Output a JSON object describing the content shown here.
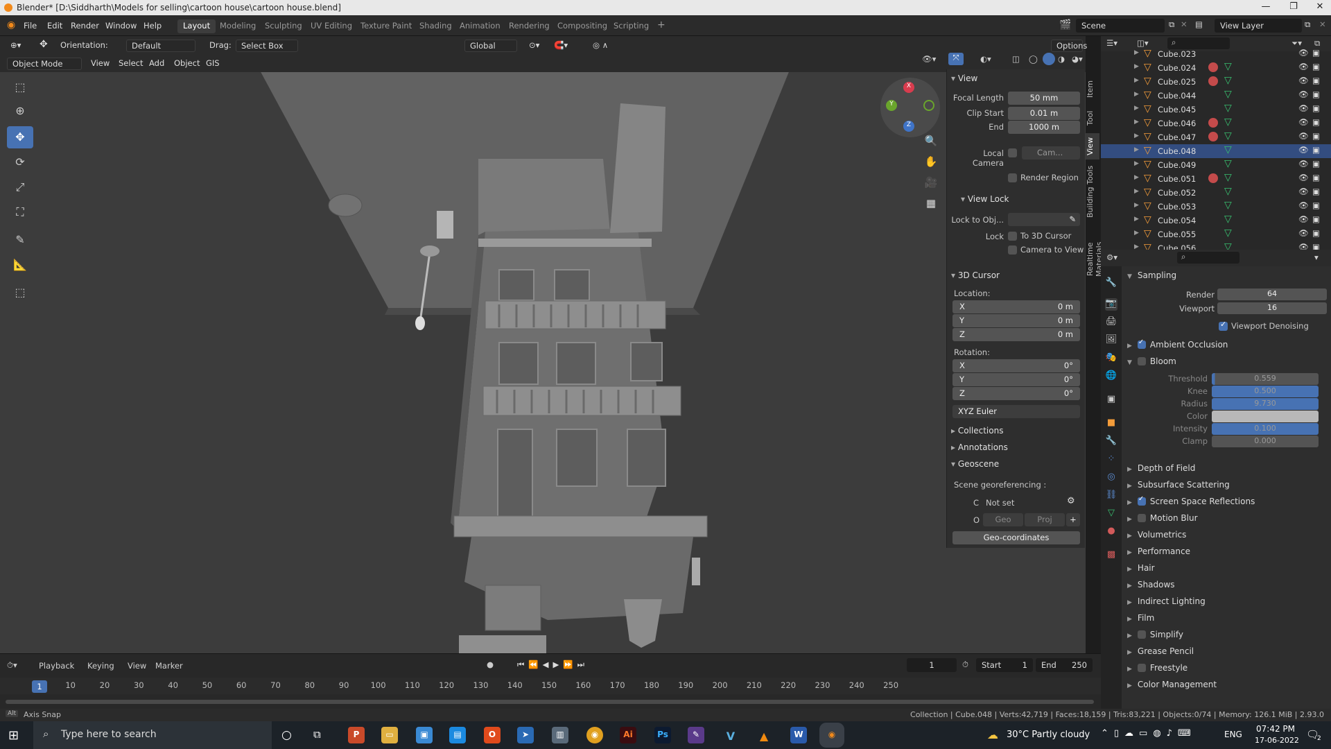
{
  "titlebar": {
    "title": "Blender* [D:\\Siddharth\\Models for selling\\cartoon house\\cartoon house.blend]",
    "minimize": "—",
    "maximize": "❐",
    "close": "✕"
  },
  "menu": [
    "File",
    "Edit",
    "Render",
    "Window",
    "Help"
  ],
  "workspaces": [
    "Layout",
    "Modeling",
    "Sculpting",
    "UV Editing",
    "Texture Paint",
    "Shading",
    "Animation",
    "Rendering",
    "Compositing",
    "Scripting"
  ],
  "workspace_add": "+",
  "scene": {
    "label": "Scene",
    "view_layer": "View Layer"
  },
  "header": {
    "orientation_label": "Orientation:",
    "orientation_value": "Default",
    "drag_label": "Drag:",
    "drag_value": "Select Box",
    "transform_orientation": "Global",
    "options": "Options"
  },
  "viewport_header": {
    "mode": "Object Mode",
    "items": [
      "View",
      "Select",
      "Add",
      "Object",
      "GIS"
    ]
  },
  "gizmo": {
    "x": "X",
    "y": "Y",
    "z": "Z"
  },
  "npanel": {
    "view_title": "View",
    "focal_length_label": "Focal Length",
    "focal_length": "50 mm",
    "clip_start_label": "Clip Start",
    "clip_start": "0.01 m",
    "end_label": "End",
    "end": "1000 m",
    "local_camera_label": "Local Camera",
    "local_camera_value": "Cam...",
    "render_region": "Render Region",
    "view_lock_title": "View Lock",
    "lock_to_obj_label": "Lock to Obj...",
    "lock_label": "Lock",
    "to_3d_cursor": "To 3D Cursor",
    "camera_to_view": "Camera to View",
    "cursor_title": "3D Cursor",
    "location_label": "Location:",
    "loc": [
      {
        "axis": "X",
        "value": "0 m"
      },
      {
        "axis": "Y",
        "value": "0 m"
      },
      {
        "axis": "Z",
        "value": "0 m"
      }
    ],
    "rotation_label": "Rotation:",
    "rot": [
      {
        "axis": "X",
        "value": "0°"
      },
      {
        "axis": "Y",
        "value": "0°"
      },
      {
        "axis": "Z",
        "value": "0°"
      }
    ],
    "rotation_mode": "XYZ Euler",
    "collections": "Collections",
    "annotations": "Annotations",
    "geoscene": "Geoscene",
    "georef_label": "Scene georeferencing :",
    "crs_c": "C",
    "crs_value": "Not set",
    "crs_o": "O",
    "geo": "Geo",
    "proj": "Proj",
    "add": "+",
    "geo_coords": "Geo-coordinates"
  },
  "side_tabs": [
    "Item",
    "Tool",
    "View",
    "Building Tools",
    "Realtime Materials"
  ],
  "outliner": {
    "rows": [
      {
        "name": "Cube.023",
        "m1": false,
        "m2": false
      },
      {
        "name": "Cube.024",
        "m1": true,
        "m2": true
      },
      {
        "name": "Cube.025",
        "m1": true,
        "m2": true
      },
      {
        "name": "Cube.044",
        "m1": false,
        "m2": true
      },
      {
        "name": "Cube.045",
        "m1": false,
        "m2": true
      },
      {
        "name": "Cube.046",
        "m1": true,
        "m2": true
      },
      {
        "name": "Cube.047",
        "m1": true,
        "m2": true
      },
      {
        "name": "Cube.048",
        "m1": false,
        "m2": true,
        "selected": true
      },
      {
        "name": "Cube.049",
        "m1": false,
        "m2": true
      },
      {
        "name": "Cube.051",
        "m1": true,
        "m2": true
      },
      {
        "name": "Cube.052",
        "m1": false,
        "m2": true
      },
      {
        "name": "Cube.053",
        "m1": false,
        "m2": true
      },
      {
        "name": "Cube.054",
        "m1": false,
        "m2": true
      },
      {
        "name": "Cube.055",
        "m1": false,
        "m2": true
      },
      {
        "name": "Cube.056",
        "m1": false,
        "m2": true
      }
    ]
  },
  "properties": {
    "sampling": "Sampling",
    "render_label": "Render",
    "render": "64",
    "viewport_label": "Viewport",
    "viewport": "16",
    "viewport_denoising": "Viewport Denoising",
    "ambient_occlusion": "Ambient Occlusion",
    "bloom": "Bloom",
    "bloom_fields": [
      {
        "label": "Threshold",
        "value": "0.559",
        "fill": 0.03
      },
      {
        "label": "Knee",
        "value": "0.500",
        "fill": 1.0
      },
      {
        "label": "Radius",
        "value": "9.730",
        "fill": 1.0
      },
      {
        "label": "Color",
        "value": "",
        "fill": 0
      },
      {
        "label": "Intensity",
        "value": "0.100",
        "fill": 1.0
      },
      {
        "label": "Clamp",
        "value": "0.000",
        "fill": 0
      }
    ],
    "sections": [
      {
        "label": "Depth of Field",
        "cb": null
      },
      {
        "label": "Subsurface Scattering",
        "cb": null
      },
      {
        "label": "Screen Space Reflections",
        "cb": true
      },
      {
        "label": "Motion Blur",
        "cb": false
      },
      {
        "label": "Volumetrics",
        "cb": null
      },
      {
        "label": "Performance",
        "cb": null
      },
      {
        "label": "Hair",
        "cb": null
      },
      {
        "label": "Shadows",
        "cb": null
      },
      {
        "label": "Indirect Lighting",
        "cb": null
      },
      {
        "label": "Film",
        "cb": null
      },
      {
        "label": "Simplify",
        "cb": false
      },
      {
        "label": "Grease Pencil",
        "cb": null
      },
      {
        "label": "Freestyle",
        "cb": false
      },
      {
        "label": "Color Management",
        "cb": null
      }
    ]
  },
  "timeline": {
    "menu": [
      "Playback",
      "Keying",
      "View",
      "Marker"
    ],
    "current_frame": "1",
    "start_label": "Start",
    "start": "1",
    "end_label": "End",
    "end": "250",
    "ticks": [
      "1",
      "10",
      "20",
      "30",
      "40",
      "50",
      "60",
      "70",
      "80",
      "90",
      "100",
      "110",
      "120",
      "130",
      "140",
      "150",
      "160",
      "170",
      "180",
      "190",
      "200",
      "210",
      "220",
      "230",
      "240",
      "250"
    ]
  },
  "statusbar": {
    "left": "Axis Snap",
    "right": "Collection | Cube.048 | Verts:42,719 | Faces:18,159 | Tris:83,221 | Objects:0/74 | Memory: 126.1 MiB | 2.93.0"
  },
  "taskbar": {
    "search": "Type here to search",
    "weather": "30°C  Partly cloudy",
    "lang": "ENG",
    "time": "07:42 PM",
    "date": "17-06-2022",
    "notif": "2"
  }
}
